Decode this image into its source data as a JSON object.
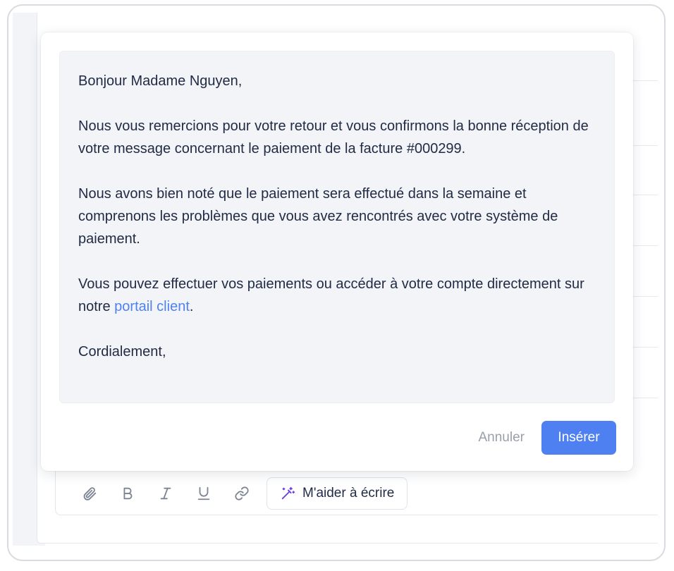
{
  "letter": {
    "greeting": "Bonjour Madame Nguyen,",
    "paragraph_1": "Nous vous remercions pour votre retour et vous confirmons la bonne réception de votre message concernant le paiement de la facture #000299.",
    "paragraph_2": "Nous avons bien noté que le paiement sera effectué dans la semaine et comprenons les problèmes que vous avez rencontrés avec votre système de paiement.",
    "paragraph_3_before_link": "Vous pouvez effectuer vos paiements ou accéder à votre compte directement sur notre ",
    "link_text": "portail client",
    "paragraph_3_after_link": ".",
    "closing": "Cordialement,"
  },
  "actions": {
    "cancel_label": "Annuler",
    "insert_label": "Insérer"
  },
  "toolbar": {
    "items": [
      {
        "icon": "paperclip-icon"
      },
      {
        "icon": "bold-icon"
      },
      {
        "icon": "italic-icon"
      },
      {
        "icon": "underline-icon"
      },
      {
        "icon": "link-icon"
      }
    ],
    "ai_button_label": "M'aider à écrire"
  },
  "colors": {
    "accent": "#4f80f2",
    "link": "#4f82f0",
    "ai_icon": "#6b3fe0",
    "text": "#1f2a44"
  }
}
